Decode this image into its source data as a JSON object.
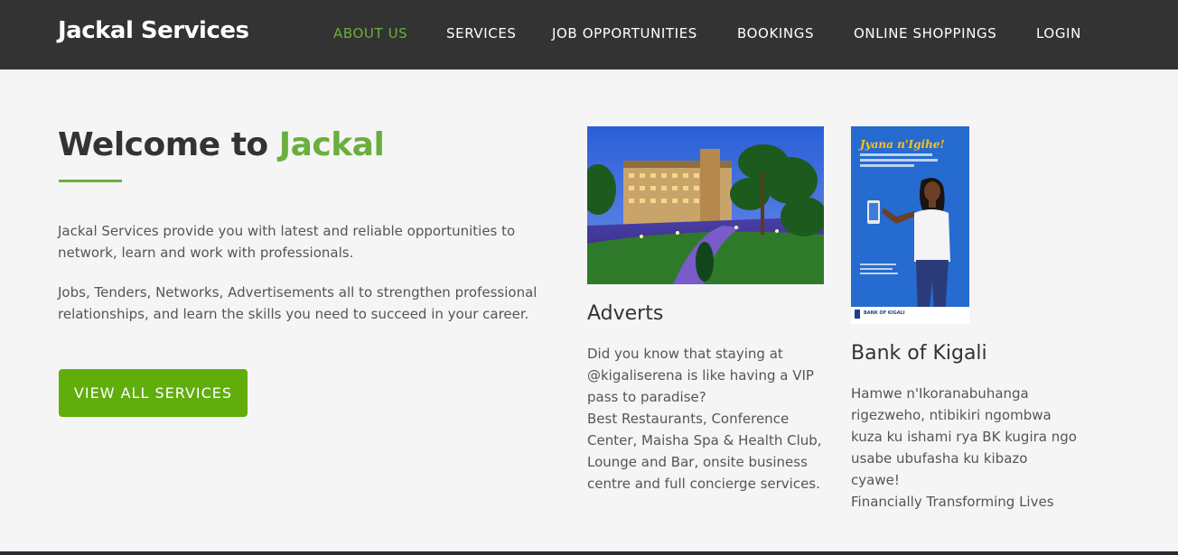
{
  "header": {
    "brand": "Jackal Services",
    "nav": [
      {
        "label": "ABOUT US",
        "active": true
      },
      {
        "label": "SERVICES",
        "active": false
      },
      {
        "label": "JOB OPPORTUNITIES",
        "active": false
      },
      {
        "label": "BOOKINGS",
        "active": false
      },
      {
        "label": "ONLINE SHOPPINGS",
        "active": false
      },
      {
        "label": "LOGIN",
        "active": false
      }
    ]
  },
  "hero": {
    "title_prefix": "Welcome to ",
    "title_accent": "Jackal",
    "paragraph1": "Jackal Services provide you with latest and reliable opportunities to network, learn and work with professionals.",
    "paragraph2": "Jobs, Tenders, Networks, Advertisements all to strengthen professional relationships, and learn the skills you need to succeed in your career.",
    "cta_label": "VIEW ALL SERVICES"
  },
  "cards": [
    {
      "title": "Adverts",
      "lines": [
        "Did you know that staying at @kigaliserena is like having a VIP pass to paradise?",
        "Best Restaurants, Conference Center, Maisha Spa & Health Club, Lounge and Bar, onsite business centre and full concierge services."
      ]
    },
    {
      "title": "Bank of Kigali",
      "lines": [
        "Hamwe n'Ikoranabuhanga rigezweho, ntibikiri ngombwa kuza ku ishami rya BK kugira ngo usabe ubufasha ku kibazo cyawe!",
        "Financially Transforming Lives"
      ],
      "poster": {
        "headline": "Jyana n'Igihe!",
        "subline": "Ishyura amazi ukoresheje BK App cyangwa Internet Banking",
        "footer": "BANK OF KIGALI"
      }
    }
  ],
  "colors": {
    "accent": "#6aaf3d",
    "button": "#60ad0c",
    "navbar": "#333333",
    "background": "#f5f5f5"
  }
}
